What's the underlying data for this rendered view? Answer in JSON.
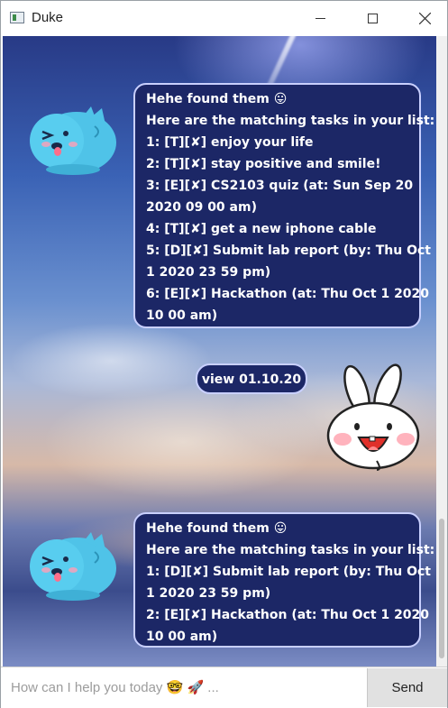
{
  "window": {
    "title": "Duke"
  },
  "chat": {
    "messages": [
      {
        "sender": "duke",
        "lines": [
          "Hehe found them 😛",
          "Here are the matching tasks in your list:",
          "1: [T][✘] enjoy your life",
          "2: [T][✘] stay positive and smile!",
          "3: [E][✘] CS2103 quiz  (at: Sun Sep 20",
          "2020 09 00 am)",
          "4: [T][✘] get a new iphone cable",
          "5: [D][✘] Submit lab report  (by: Thu Oct",
          "1 2020 23 59 pm)",
          "6: [E][✘] Hackathon  (at: Thu Oct 1 2020",
          "10 00 am)"
        ]
      },
      {
        "sender": "user",
        "text": "view 01.10.20"
      },
      {
        "sender": "duke",
        "lines": [
          "Hehe found them 😛",
          "Here are the matching tasks in your list:",
          "1: [D][✘] Submit lab report  (by: Thu Oct",
          "1 2020 23 59 pm)",
          "2: [E][✘] Hackathon  (at: Thu Oct 1 2020",
          "10 00 am)"
        ]
      }
    ]
  },
  "input": {
    "placeholder": "How can I help you today 🤓 🚀 ...",
    "value": ""
  },
  "send_label": "Send",
  "colors": {
    "bubble_bg": "#1c2766",
    "bubble_border": "#c9d0ff",
    "duke_avatar": "#4fc3e8",
    "user_avatar": "#ffffff"
  }
}
